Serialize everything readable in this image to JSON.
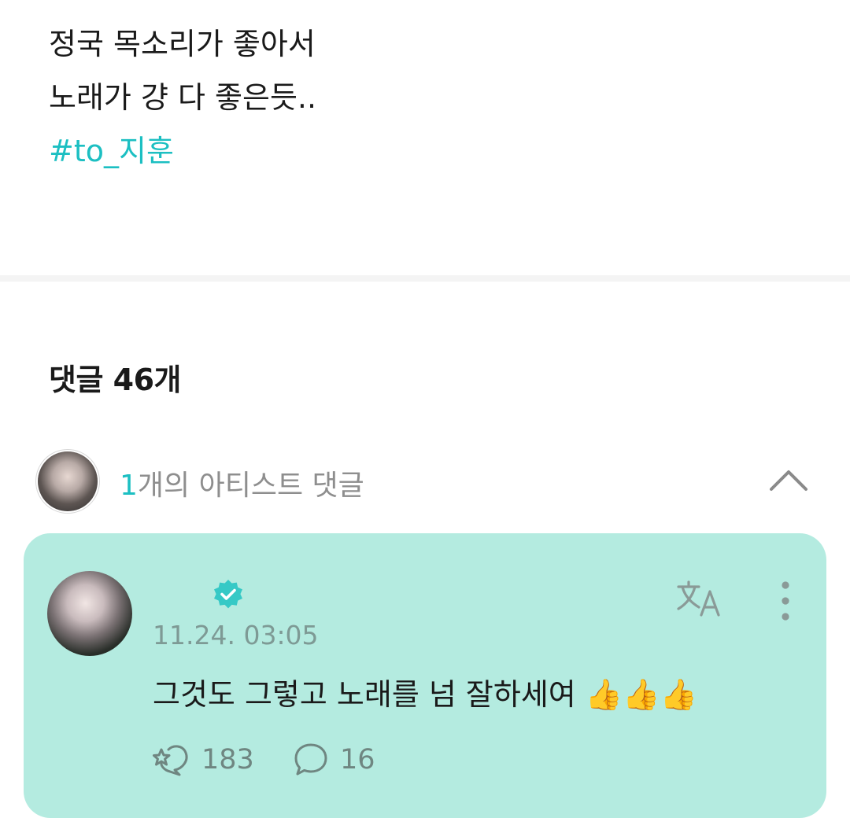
{
  "post": {
    "lines": [
      "정국 목소리가 좋아서",
      "노래가 걍 다 좋은듯.."
    ],
    "hashtag": "#to_지훈"
  },
  "comments": {
    "heading": "댓글 46개"
  },
  "artist_comments": {
    "count": "1",
    "label": "개의 아티스트 댓글"
  },
  "comment": {
    "timestamp": "11.24. 03:05",
    "text": "그것도 그렇고 노래를 넘 잘하세여 👍👍👍",
    "like_count": "183",
    "reply_count": "16",
    "icons": {
      "verified": "verified-check-icon",
      "translate": "translate-icon",
      "more": "more-vertical-icon",
      "like": "like-icon",
      "reply": "reply-bubble-icon"
    }
  },
  "colors": {
    "accent": "#1cbfc2",
    "card_bg": "#b4ebe0",
    "muted": "#8e8e8e"
  }
}
